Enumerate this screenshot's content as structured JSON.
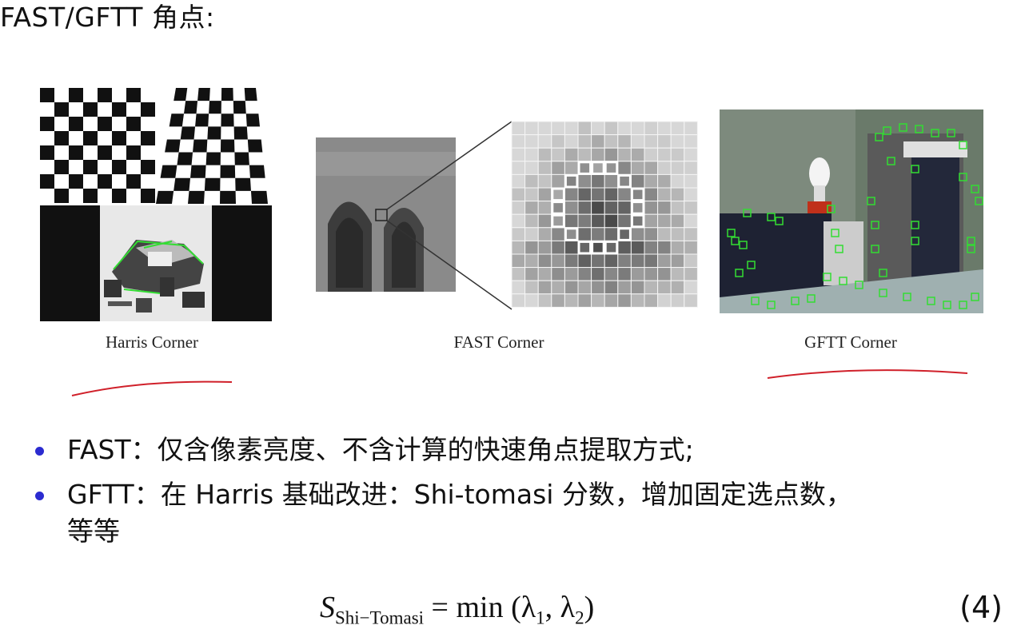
{
  "slide": {
    "title": "FAST/GFTT 角点:"
  },
  "figures": [
    {
      "id": "harris",
      "caption": "Harris Corner"
    },
    {
      "id": "fast",
      "caption": "FAST Corner"
    },
    {
      "id": "gftt",
      "caption": "GFTT Corner"
    }
  ],
  "bullets": [
    {
      "text": "FAST：仅含像素亮度、不含计算的快速角点提取方式;"
    },
    {
      "text": "GFTT：在 Harris 基础改进：Shi-tomasi 分数，增加固定选点数，",
      "continuation": "等等"
    }
  ],
  "formula": {
    "lhs_symbol": "S",
    "lhs_subscript": "Shi−Tomasi",
    "rhs": "= min (λ",
    "sub1": "1",
    "mid": ", λ",
    "sub2": "2",
    "close": ")",
    "number": "(4)"
  },
  "colors": {
    "bullet": "#2b2bd0",
    "annotation": "#d0202a",
    "corner_marker": "#33dd33"
  }
}
